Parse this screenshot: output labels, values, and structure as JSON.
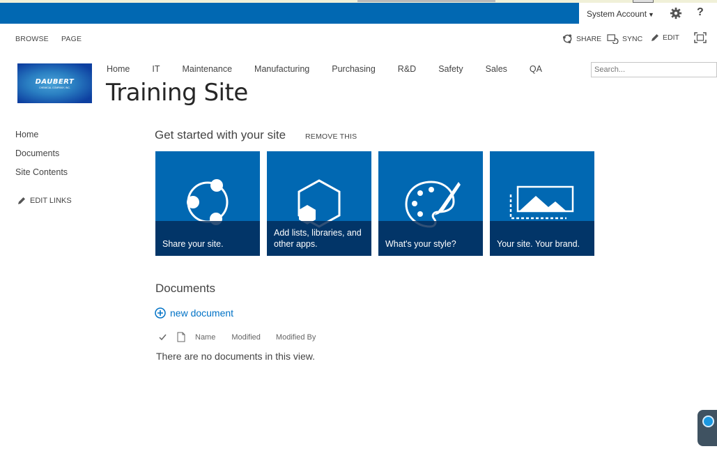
{
  "suite": {
    "account": "System Account",
    "help": "?"
  },
  "ribbon": {
    "tabs": [
      "BROWSE",
      "PAGE"
    ],
    "actions": {
      "share": "SHARE",
      "sync": "SYNC",
      "edit": "EDIT"
    }
  },
  "logo": {
    "main": "DAUBERT",
    "sub": "CHEMICAL COMPANY, INC."
  },
  "topnav": [
    "Home",
    "IT",
    "Maintenance",
    "Manufacturing",
    "Purchasing",
    "R&D",
    "Safety",
    "Sales",
    "QA"
  ],
  "site_title": "Training Site",
  "search": {
    "placeholder": "Search..."
  },
  "quicklaunch": {
    "items": [
      "Home",
      "Documents",
      "Site Contents"
    ],
    "edit_links": "EDIT LINKS"
  },
  "get_started": {
    "heading": "Get started with your site",
    "remove": "REMOVE THIS",
    "tiles": [
      {
        "label": "Share your site.",
        "icon": "share-icon"
      },
      {
        "label": "Add lists, libraries, and other apps.",
        "icon": "apps-icon"
      },
      {
        "label": "What's your style?",
        "icon": "palette-icon"
      },
      {
        "label": "Your site. Your brand.",
        "icon": "image-icon"
      }
    ]
  },
  "documents": {
    "heading": "Documents",
    "new_document": "new document",
    "columns": [
      "Name",
      "Modified",
      "Modified By"
    ],
    "empty_message": "There are no documents in this view."
  },
  "colors": {
    "suite_bar": "#0168b2",
    "tile": "#0168b2",
    "link": "#0072c6"
  }
}
